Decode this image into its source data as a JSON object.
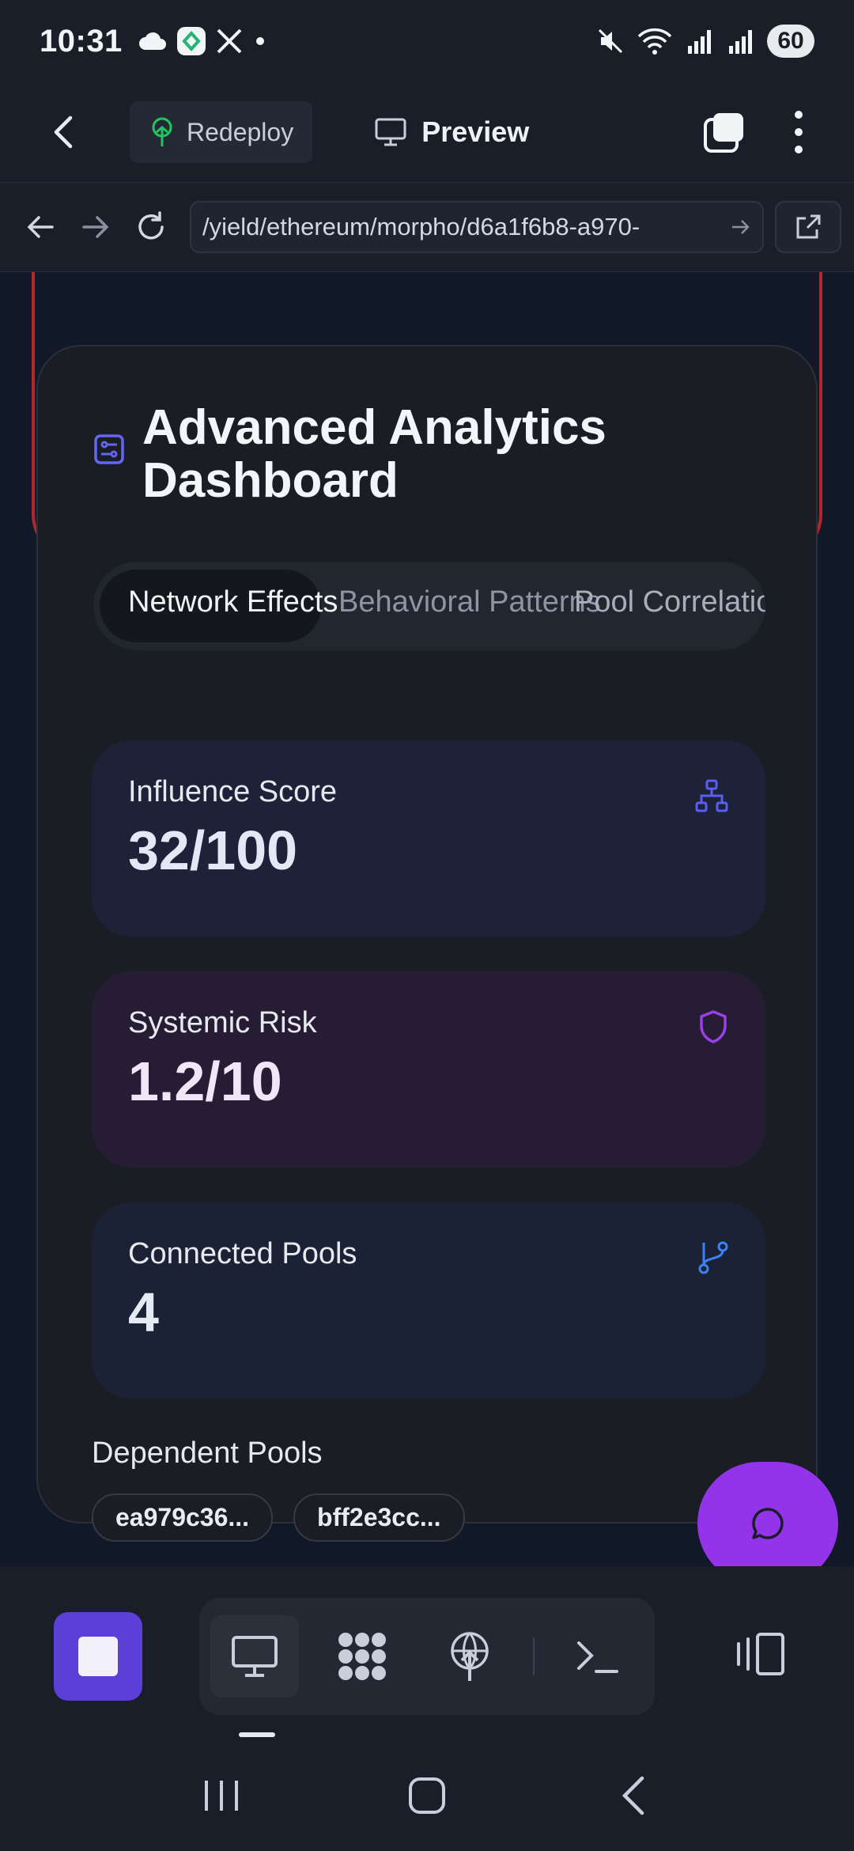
{
  "status_bar": {
    "time": "10:31",
    "battery": "60"
  },
  "toolbar": {
    "redeploy_label": "Redeploy",
    "preview_label": "Preview"
  },
  "url_bar": {
    "url": "/yield/ethereum/morpho/d6a1f6b8-a970-"
  },
  "dashboard": {
    "title": "Advanced Analytics Dashboard",
    "tabs": [
      {
        "label": "Network Effects",
        "active": true
      },
      {
        "label": "Behavioral Patterns",
        "active": false
      },
      {
        "label": "Pool Correlations",
        "active": false
      }
    ],
    "stats": [
      {
        "label": "Influence Score",
        "value": "32/100",
        "icon": "network-icon"
      },
      {
        "label": "Systemic Risk",
        "value": "1.2/10",
        "icon": "shield-icon"
      },
      {
        "label": "Connected Pools",
        "value": "4",
        "icon": "git-branch-icon"
      }
    ],
    "dependent_pools_label": "Dependent Pools",
    "dependent_pools": [
      "ea979c36...",
      "bff2e3cc..."
    ]
  },
  "colors": {
    "accent_purple": "#9333ea",
    "stop_button": "#5b3fd6",
    "warning_border": "#b0282d"
  }
}
